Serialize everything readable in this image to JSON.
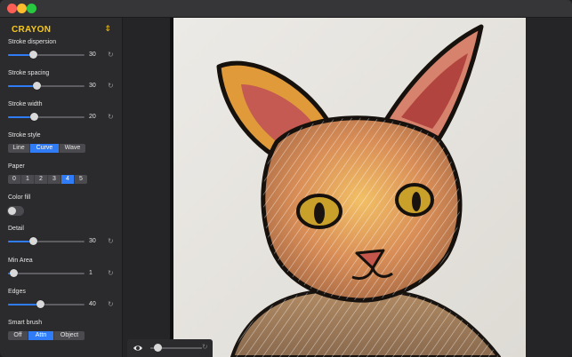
{
  "preset": {
    "name": "CRAYON",
    "chevron": "⇕"
  },
  "params": {
    "stroke_dispersion": {
      "label": "Stroke dispersion",
      "value": "30"
    },
    "stroke_spacing": {
      "label": "Stroke spacing",
      "value": "30"
    },
    "stroke_width": {
      "label": "Stroke width",
      "value": "20"
    },
    "detail": {
      "label": "Detail",
      "value": "30"
    },
    "min_area": {
      "label": "Min Area",
      "value": "1"
    },
    "edges": {
      "label": "Edges",
      "value": "40"
    }
  },
  "stroke_style": {
    "label": "Stroke style",
    "options": [
      "Line",
      "Curve",
      "Wave"
    ],
    "selected": "Curve"
  },
  "paper": {
    "label": "Paper",
    "options": [
      "0",
      "1",
      "2",
      "3",
      "4",
      "5"
    ],
    "selected": "4"
  },
  "color_fill": {
    "label": "Color fill",
    "on": false
  },
  "smart_brush": {
    "label": "Smart brush",
    "options": [
      "Off",
      "Attn",
      "Object"
    ],
    "selected": "Attn"
  },
  "reset_glyph": "↻",
  "colors": {
    "accent": "#2f7cf6",
    "preset": "#f7c91d"
  }
}
